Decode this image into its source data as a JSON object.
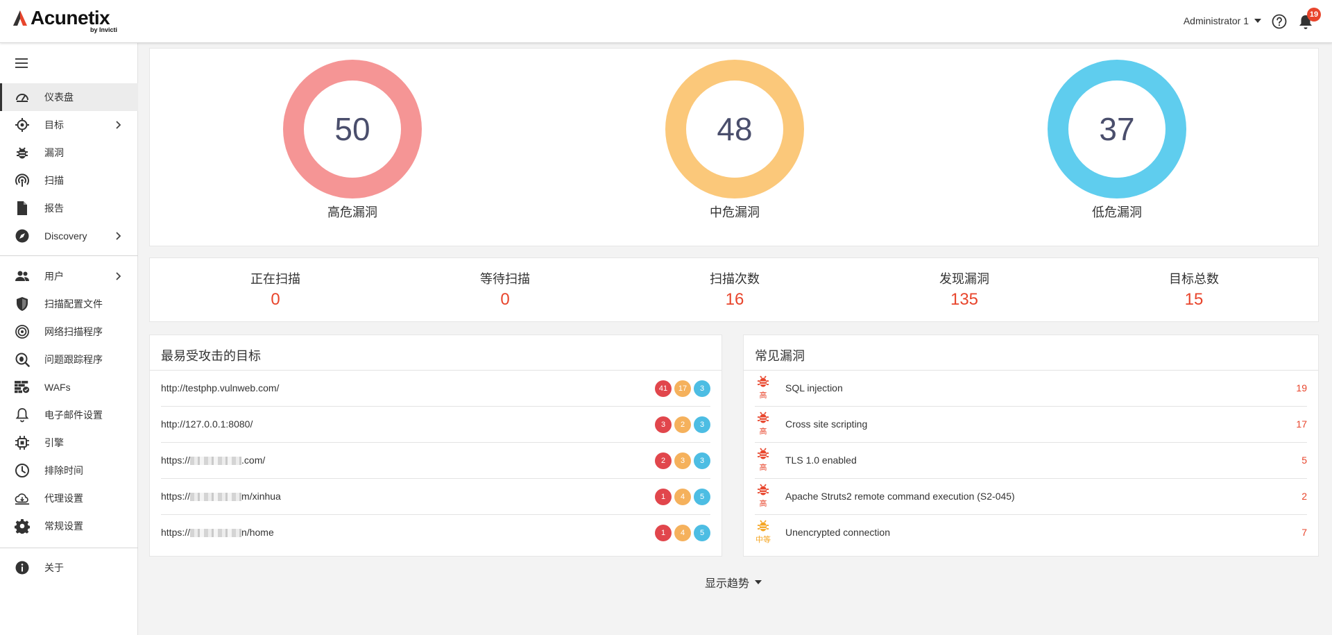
{
  "header": {
    "brand": "Acunetix",
    "brand_sub": "by Invicti",
    "user": "Administrator 1",
    "notifications": "19"
  },
  "sidebar": {
    "items": [
      {
        "label": "仪表盘",
        "icon": "dashboard-icon"
      },
      {
        "label": "目标",
        "icon": "target-icon"
      },
      {
        "label": "漏洞",
        "icon": "bug-icon"
      },
      {
        "label": "扫描",
        "icon": "scan-icon"
      },
      {
        "label": "报告",
        "icon": "report-icon"
      },
      {
        "label": "Discovery",
        "icon": "compass-icon"
      },
      {
        "label": "用户",
        "icon": "users-icon"
      },
      {
        "label": "扫描配置文件",
        "icon": "shield-icon"
      },
      {
        "label": "网络扫描程序",
        "icon": "network-scanner-icon"
      },
      {
        "label": "问题跟踪程序",
        "icon": "issue-tracker-icon"
      },
      {
        "label": "WAFs",
        "icon": "firewall-icon"
      },
      {
        "label": "电子邮件设置",
        "icon": "bell-icon"
      },
      {
        "label": "引擎",
        "icon": "chip-icon"
      },
      {
        "label": "排除时间",
        "icon": "clock-icon"
      },
      {
        "label": "代理设置",
        "icon": "cloud-icon"
      },
      {
        "label": "常规设置",
        "icon": "gear-icon"
      },
      {
        "label": "关于",
        "icon": "info-icon"
      }
    ]
  },
  "severity": [
    {
      "value": "50",
      "label": "高危漏洞",
      "color": "#f59595"
    },
    {
      "value": "48",
      "label": "中危漏洞",
      "color": "#fbc87a"
    },
    {
      "value": "37",
      "label": "低危漏洞",
      "color": "#5fcdee"
    }
  ],
  "stats": [
    {
      "title": "正在扫描",
      "value": "0"
    },
    {
      "title": "等待扫描",
      "value": "0"
    },
    {
      "title": "扫描次数",
      "value": "16"
    },
    {
      "title": "发现漏洞",
      "value": "135"
    },
    {
      "title": "目标总数",
      "value": "15"
    }
  ],
  "targets": {
    "title": "最易受攻击的目标",
    "rows": [
      {
        "url_prefix": "http://testphp.vulnweb.com/",
        "url_suffix": "",
        "high": "41",
        "medium": "17",
        "low": "3"
      },
      {
        "url_prefix": "http://127.0.0.1:8080/",
        "url_suffix": "",
        "high": "3",
        "medium": "2",
        "low": "3"
      },
      {
        "url_prefix": "https://",
        "url_suffix": ".com/",
        "high": "2",
        "medium": "3",
        "low": "3"
      },
      {
        "url_prefix": "https://",
        "url_suffix": "m/xinhua",
        "high": "1",
        "medium": "4",
        "low": "5"
      },
      {
        "url_prefix": "https://",
        "url_suffix": "n/home",
        "high": "1",
        "medium": "4",
        "low": "5"
      }
    ]
  },
  "vulns": {
    "title": "常见漏洞",
    "rows": [
      {
        "severity": "高",
        "name": "SQL injection",
        "count": "19",
        "color": "#e8452c"
      },
      {
        "severity": "高",
        "name": "Cross site scripting",
        "count": "17",
        "color": "#e8452c"
      },
      {
        "severity": "高",
        "name": "TLS 1.0 enabled",
        "count": "5",
        "color": "#e8452c"
      },
      {
        "severity": "高",
        "name": "Apache Struts2 remote command execution (S2-045)",
        "count": "2",
        "color": "#e8452c"
      },
      {
        "severity": "中等",
        "name": "Unencrypted connection",
        "count": "7",
        "color": "#f5a623"
      }
    ]
  },
  "trend_label": "显示趋势"
}
